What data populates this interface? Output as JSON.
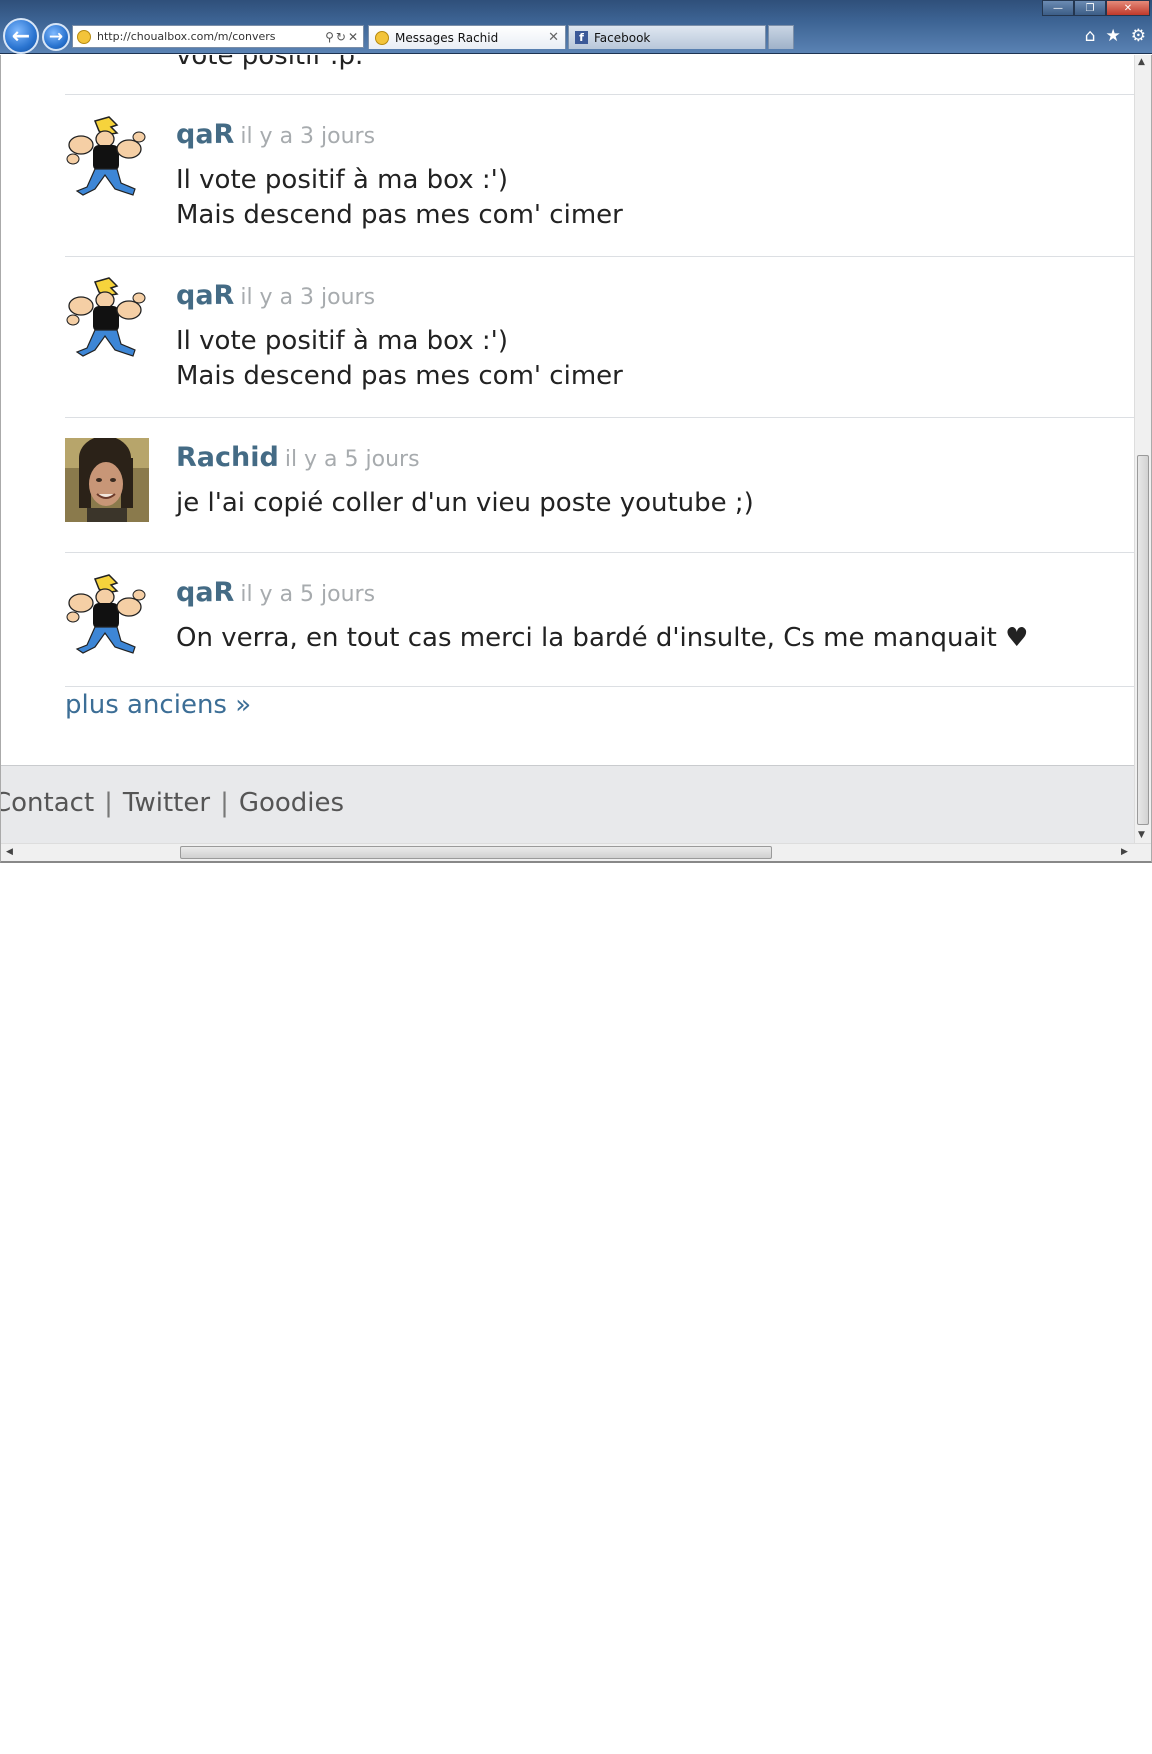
{
  "browser": {
    "address_url": "http://choualbox.com/m/convers",
    "tabs": [
      {
        "label": "Messages Rachid",
        "active": true
      },
      {
        "label": "Facebook",
        "active": false
      }
    ]
  },
  "page": {
    "partial_previous_text": "vote positif :p.",
    "messages": [
      {
        "author": "qaR",
        "time": "il y a 3 jours",
        "text": "Il vote positif à ma box :')\nMais descend pas mes com' cimer",
        "avatar": "cartoon-avatar"
      },
      {
        "author": "qaR",
        "time": "il y a 3 jours",
        "text": "Il vote positif à ma box :')\nMais descend pas mes com' cimer",
        "avatar": "cartoon-avatar"
      },
      {
        "author": "Rachid",
        "time": "il y a 5 jours",
        "text": "je l'ai copié coller d'un vieu poste youtube ;)",
        "avatar": "photo-avatar"
      },
      {
        "author": "qaR",
        "time": "il y a 5 jours",
        "text": "On verra, en tout cas merci la bardé d'insulte, Cs me manquait ♥",
        "avatar": "cartoon-avatar"
      }
    ],
    "older_link": "plus anciens »",
    "footer_links": [
      "Contact",
      "Twitter",
      "Goodies"
    ],
    "footer_sep": "|"
  },
  "colors": {
    "author": "#446b85",
    "time": "#a7abae",
    "link": "#3c6e96",
    "footer_bg": "#e8e9eb"
  }
}
